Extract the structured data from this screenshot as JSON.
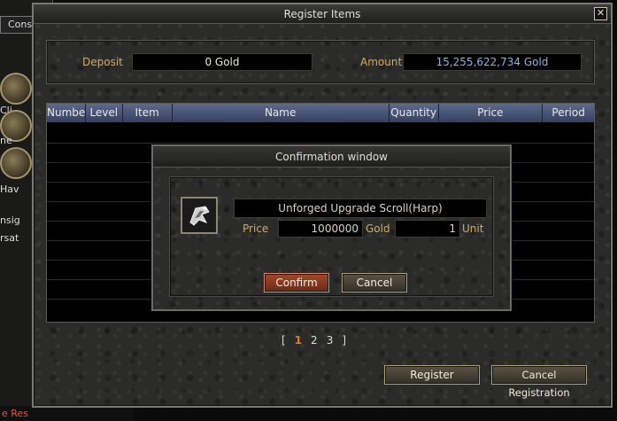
{
  "background": {
    "title_fragment": "Cons",
    "side_texts": [
      "Cli",
      "ne",
      "Hav",
      "nsig",
      "rsat"
    ],
    "bottom_text": "e Res"
  },
  "window": {
    "title": "Register Items",
    "close_glyph": "✕"
  },
  "deposit": {
    "label": "Deposit",
    "value": "0 Gold"
  },
  "amount": {
    "label": "Amount",
    "value": "15,255,622,734 Gold"
  },
  "table": {
    "columns": [
      "Number",
      "Level",
      "Item",
      "Name",
      "Quantity",
      "Price",
      "Period"
    ]
  },
  "pager": {
    "open": "[",
    "pages": [
      "1",
      "2",
      "3"
    ],
    "close": "]",
    "current": "1"
  },
  "buttons": {
    "register": "Register",
    "cancel_registration": "Cancel Registration"
  },
  "dialog": {
    "title": "Confirmation window",
    "item_name": "Unforged Upgrade Scroll(Harp)",
    "price_label": "Price",
    "price_value": "1000000",
    "gold_label": "Gold",
    "unit_value": "1",
    "unit_label": "Unit",
    "confirm": "Confirm",
    "cancel": "Cancel",
    "icon": "scroll-item-icon"
  },
  "colors": {
    "label_gold": "#d9a85a",
    "amount_blue": "#8fb3e6",
    "header_blue": "#4a5678",
    "active_page": "#f07a1c",
    "confirm_red": "#8a3a22"
  }
}
